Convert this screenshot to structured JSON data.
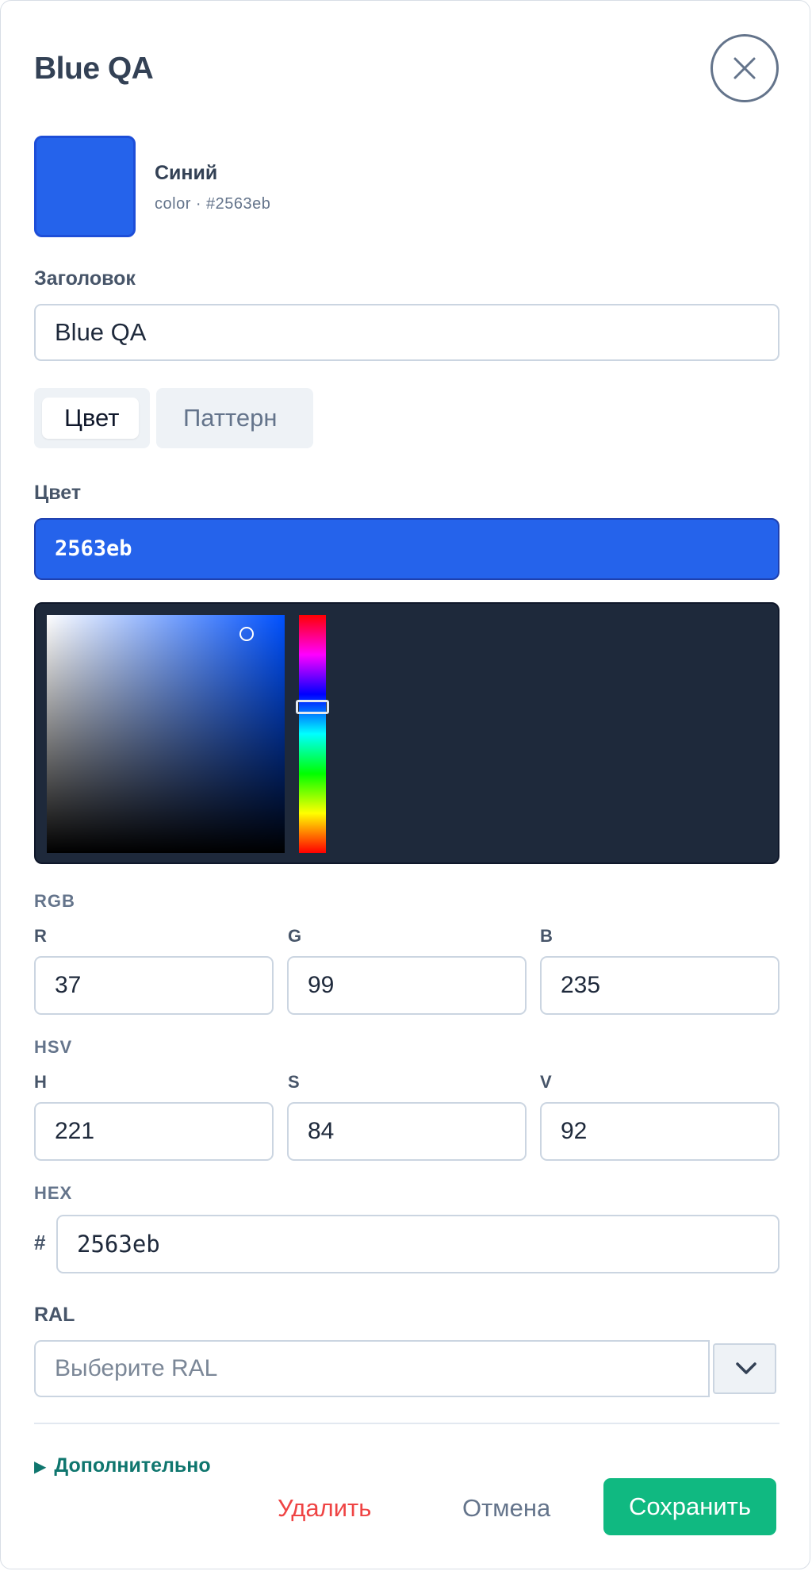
{
  "header": {
    "title": "Blue QA",
    "close_icon": "close-icon"
  },
  "preview": {
    "name": "Синий",
    "type": "color",
    "separator": "·",
    "hex_display": "#2563eb",
    "swatch_color": "#2563eb"
  },
  "title_field": {
    "label": "Заголовок",
    "value": "Blue QA"
  },
  "tabs": [
    {
      "label": "Цвет",
      "selected": true
    },
    {
      "label": "Паттерн",
      "selected": false
    }
  ],
  "color_field": {
    "label": "Цвет",
    "value": "2563eb",
    "color": "#2563eb"
  },
  "picker": {
    "hue": 221,
    "saturation": 84,
    "value": 92,
    "background": "#1e293b"
  },
  "rgb": {
    "section": "RGB",
    "r_label": "R",
    "r": "37",
    "g_label": "G",
    "g": "99",
    "b_label": "B",
    "b": "235"
  },
  "hsv": {
    "section": "HSV",
    "h_label": "H",
    "h": "221",
    "s_label": "S",
    "s": "84",
    "v_label": "V",
    "v": "92"
  },
  "hex": {
    "section": "HEX",
    "prefix": "#",
    "value": "2563eb"
  },
  "ral": {
    "label": "RAL",
    "placeholder": "Выберите RAL",
    "value": "",
    "toggle_icon": "chevron-down-icon"
  },
  "advanced": {
    "label": "Дополнительно",
    "icon": "triangle-right-icon"
  },
  "actions": {
    "delete_label": "Удалить",
    "cancel_label": "Отмена",
    "save_label": "Сохранить",
    "delete_color": "#ef4444",
    "cancel_color": "#64748b",
    "save_color": "#10b981"
  }
}
